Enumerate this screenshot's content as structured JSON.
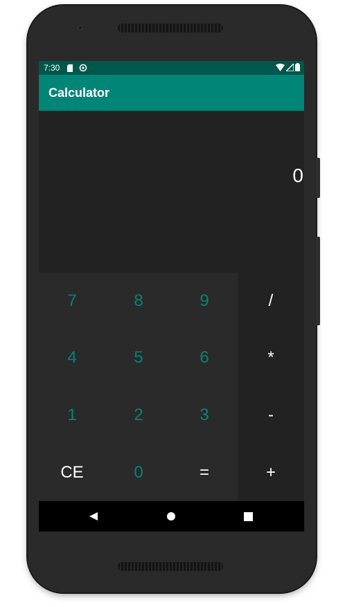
{
  "status_bar": {
    "time": "7:30",
    "icons_left": [
      "sd-card-icon",
      "sync-icon"
    ],
    "icons_right": [
      "wifi-icon",
      "cell-signal-icon",
      "battery-icon"
    ]
  },
  "app_bar": {
    "title": "Calculator"
  },
  "display": {
    "value": "0"
  },
  "keys": {
    "k7": "7",
    "k8": "8",
    "k9": "9",
    "k4": "4",
    "k5": "5",
    "k6": "6",
    "k1": "1",
    "k2": "2",
    "k3": "3",
    "ce": "CE",
    "k0": "0",
    "equals": "="
  },
  "operators": {
    "divide": "/",
    "multiply": "*",
    "subtract": "-",
    "add": "+"
  },
  "nav_bar": {
    "buttons": [
      "back-icon",
      "home-icon",
      "recents-icon"
    ]
  },
  "colors": {
    "status_bar": "#00574b",
    "app_bar": "#008577",
    "digit_text": "#008577",
    "background": "#222222",
    "keypad": "#2a2a2a"
  }
}
